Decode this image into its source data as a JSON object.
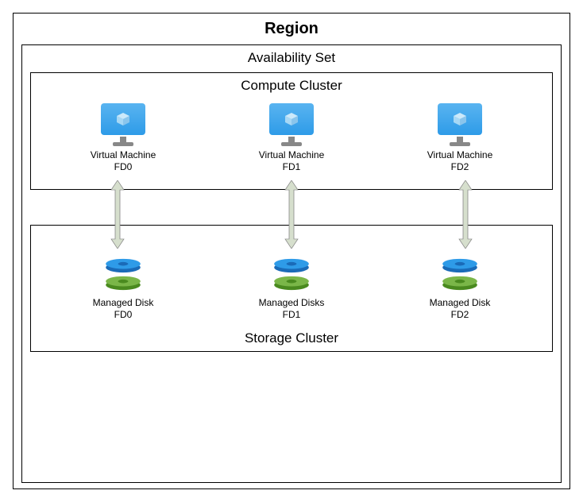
{
  "region": {
    "title": "Region"
  },
  "availability": {
    "title": "Availability Set"
  },
  "compute": {
    "title": "Compute Cluster"
  },
  "storage": {
    "title": "Storage Cluster"
  },
  "vms": [
    {
      "name": "Virtual Machine",
      "fd": "FD0"
    },
    {
      "name": "Virtual Machine",
      "fd": "FD1"
    },
    {
      "name": "Virtual Machine",
      "fd": "FD2"
    }
  ],
  "disks": [
    {
      "name": "Managed Disk",
      "fd": "FD0"
    },
    {
      "name": "Managed Disks",
      "fd": "FD1"
    },
    {
      "name": "Managed Disk",
      "fd": "FD2"
    }
  ]
}
